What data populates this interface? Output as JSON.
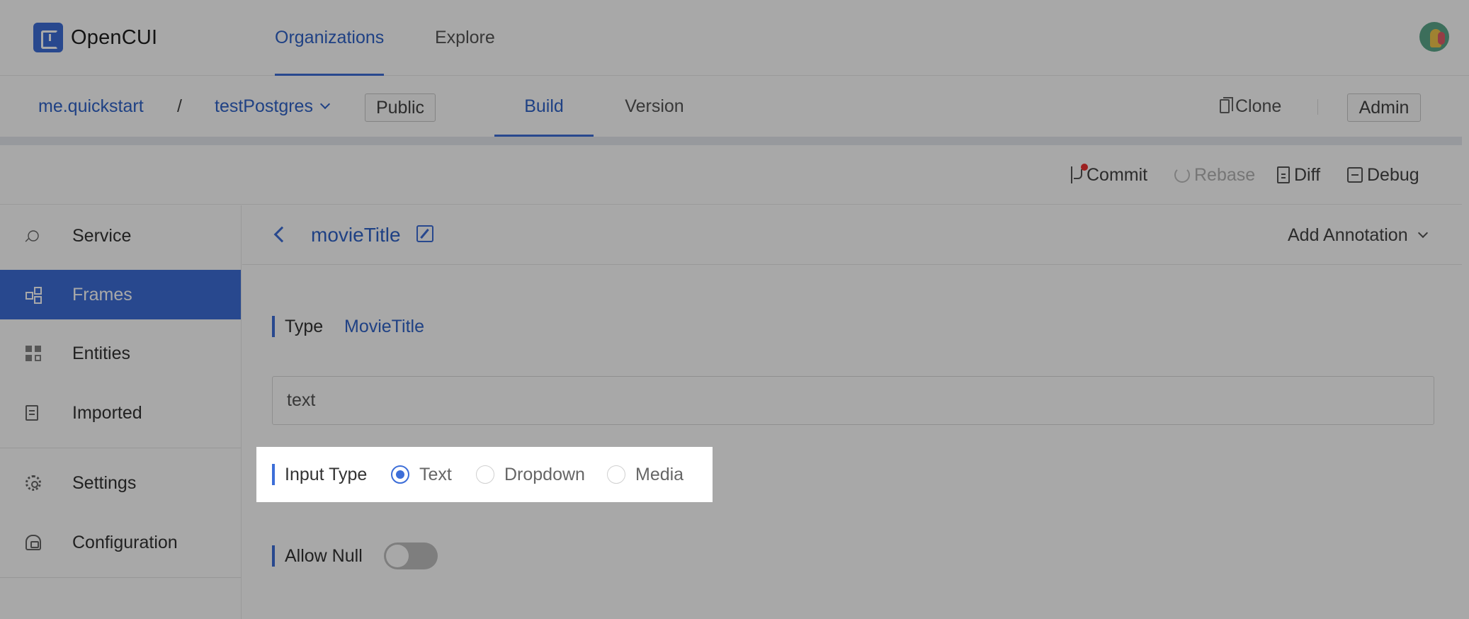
{
  "app": {
    "name": "OpenCUI"
  },
  "topnav": {
    "organizations": "Organizations",
    "explore": "Explore"
  },
  "project": {
    "org": "me.quickstart",
    "separator": "/",
    "name": "testPostgres",
    "visibility": "Public",
    "tabs": [
      {
        "label": "Build",
        "active": true
      },
      {
        "label": "Version",
        "active": false
      }
    ],
    "clone": "Clone",
    "admin": "Admin"
  },
  "toolbar": {
    "commit": "Commit",
    "rebase": "Rebase",
    "diff": "Diff",
    "debug": "Debug"
  },
  "sidebar": {
    "items": [
      {
        "label": "Service",
        "icon": "plug-icon"
      },
      {
        "label": "Frames",
        "icon": "frames-icon",
        "active": true
      },
      {
        "label": "Entities",
        "icon": "grid-icon"
      },
      {
        "label": "Imported",
        "icon": "import-icon"
      },
      {
        "label": "Settings",
        "icon": "gear-icon"
      },
      {
        "label": "Configuration",
        "icon": "config-icon"
      }
    ]
  },
  "main": {
    "title": "movieTitle",
    "add_annotation": "Add Annotation",
    "type_label": "Type",
    "type_value": "MovieTitle",
    "text_field_placeholder": "text",
    "input_type_label": "Input Type",
    "input_type_options": [
      "Text",
      "Dropdown",
      "Media"
    ],
    "input_type_selected": "Text",
    "allow_null_label": "Allow Null",
    "allow_null_on": false
  },
  "colors": {
    "accent": "#3d6ed8",
    "overlay": "rgba(0,0,0,0.34)",
    "commit_dot": "#e33333"
  }
}
